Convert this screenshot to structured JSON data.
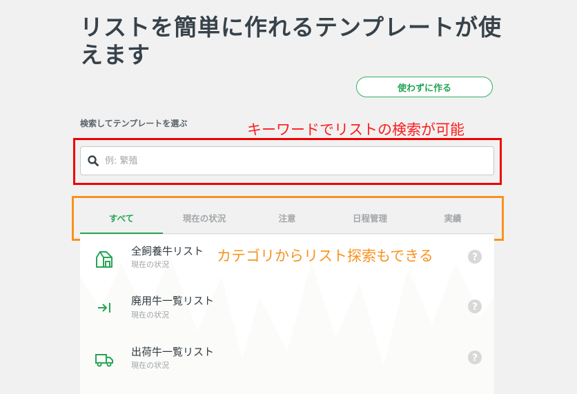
{
  "page": {
    "title": "リストを簡単に作れるテンプレートが使えます"
  },
  "actions": {
    "make_without_template": "使わずに作る"
  },
  "search": {
    "label": "検索してテンプレートを選ぶ",
    "placeholder": "例: 繁殖",
    "value": ""
  },
  "annotations": {
    "keyword_note": "キーワードでリストの検索が可能",
    "category_note": "カテゴリからリスト探索もできる",
    "red_color": "#ee0000",
    "orange_color": "#f7931e"
  },
  "tabs": [
    {
      "label": "すべて",
      "active": true
    },
    {
      "label": "現在の状況",
      "active": false
    },
    {
      "label": "注意",
      "active": false
    },
    {
      "label": "日程管理",
      "active": false
    },
    {
      "label": "実績",
      "active": false
    }
  ],
  "templates": [
    {
      "title": "全飼養牛リスト",
      "subtitle": "現在の状況",
      "icon": "barn-icon"
    },
    {
      "title": "廃用牛一覧リスト",
      "subtitle": "現在の状況",
      "icon": "exit-arrow-icon"
    },
    {
      "title": "出荷牛一覧リスト",
      "subtitle": "現在の状況",
      "icon": "truck-icon"
    }
  ],
  "colors": {
    "accent": "#25a455",
    "title": "#37424a",
    "background": "#f1f1f1"
  }
}
